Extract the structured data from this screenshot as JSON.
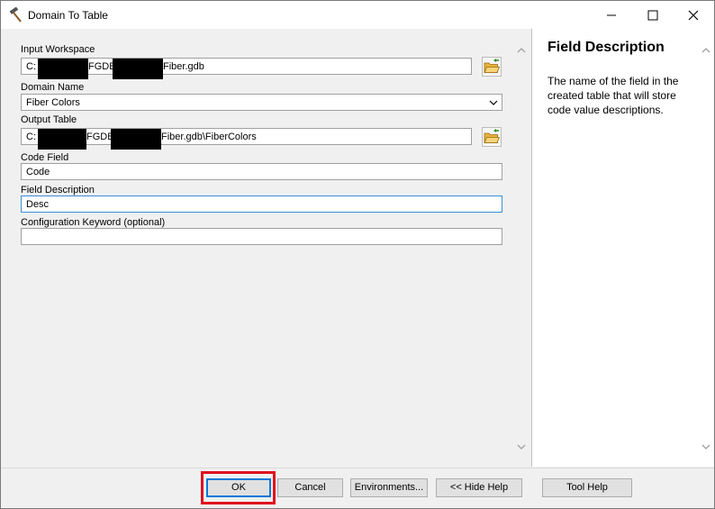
{
  "window": {
    "title": "Domain To Table",
    "app_icon": "hammer-icon"
  },
  "form": {
    "input_workspace": {
      "label": "Input Workspace",
      "segments": [
        "C:",
        "FGDB",
        "Fiber.gdb"
      ]
    },
    "domain_name": {
      "label": "Domain Name",
      "value": "Fiber Colors"
    },
    "output_table": {
      "label": "Output Table",
      "segments": [
        "C:",
        "FGDB",
        "Fiber.gdb\\FiberColors"
      ]
    },
    "code_field": {
      "label": "Code Field",
      "value": "Code"
    },
    "field_description": {
      "label": "Field Description",
      "value": "Desc"
    },
    "configuration_keyword": {
      "label": "Configuration Keyword (optional)",
      "value": ""
    }
  },
  "help": {
    "title": "Field Description",
    "text": "The name of the field in the created table that will store code value descriptions."
  },
  "buttons": {
    "ok": "OK",
    "cancel": "Cancel",
    "environments": "Environments...",
    "hide_help": "<< Hide Help",
    "tool_help": "Tool Help"
  },
  "colors": {
    "highlight": "#e0101e",
    "focus": "#3c8dd8",
    "folder": "#e8b23a"
  }
}
